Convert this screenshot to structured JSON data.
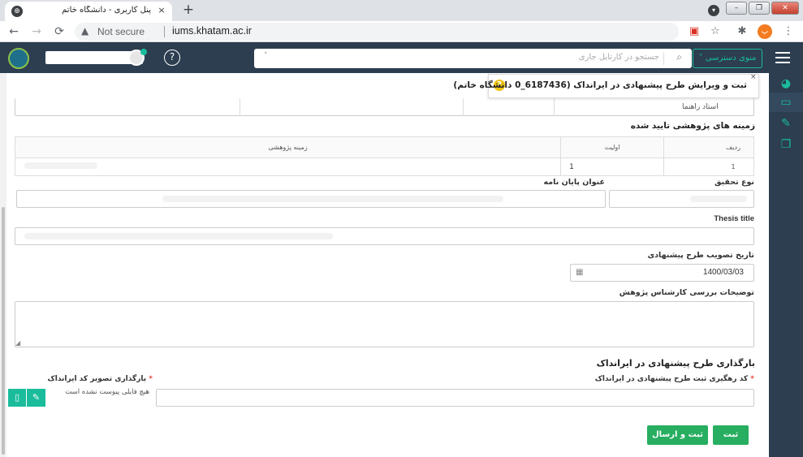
{
  "browser": {
    "tab_title": "پنل کاربری - دانشگاه خاتم",
    "tab_close": "×",
    "new_tab": "+",
    "nav_back": "←",
    "nav_forward": "→",
    "nav_reload": "⟳",
    "not_secure": "Not secure",
    "url": "iums.khatam.ac.ir",
    "menu": "⋮"
  },
  "header": {
    "help": "?",
    "search_placeholder": "جستجو در کارتابل جاری",
    "search_icon": "🔍",
    "access_menu": "منوی دسترسی ˅"
  },
  "page": {
    "title": "ثبت و ویرایش طرح پیشنهادی در ایرانداک (6187436_0 دانشگاه خاتم)",
    "title_help": "?",
    "title_close": "×"
  },
  "advisor_row": {
    "label": "استاد راهنما"
  },
  "research_section": {
    "title": "زمینه های پژوهشی تایید شده",
    "columns": [
      "ردیف",
      "اولیت",
      "زمینه پژوهشی"
    ],
    "rows": [
      {
        "row": "1",
        "priority": "1",
        "field": ""
      }
    ]
  },
  "form": {
    "research_type_label": "نوع تحقیق",
    "thesis_title_fa_label": "عنوان پایان نامه",
    "thesis_title_en_label": "Thesis title",
    "approval_date_label": "تاریخ تصویب طرح پیشنهادی",
    "approval_date_value": "1400/03/03",
    "calendar_icon": "▦",
    "reviewer_notes_label": "توضیحات بررسی کارشناس پژوهش"
  },
  "upload_section": {
    "title": "بارگذاری طرح پیشنهادی در ایرانداک",
    "tracking_code_label": "کد رهگیری ثبت طرح پیشنهادی در ایرانداک",
    "image_label": "بارگذاری تصویر کد ایرانداک",
    "no_file": "هیچ فایلی پیوست نشده است",
    "required_mark": "*"
  },
  "actions": {
    "save": "ثبت",
    "save_and_send": "ثبت و ارسال"
  },
  "colors": {
    "accent": "#1abc9c",
    "header_bg": "#2c3e50",
    "button_green": "#27ae60"
  }
}
